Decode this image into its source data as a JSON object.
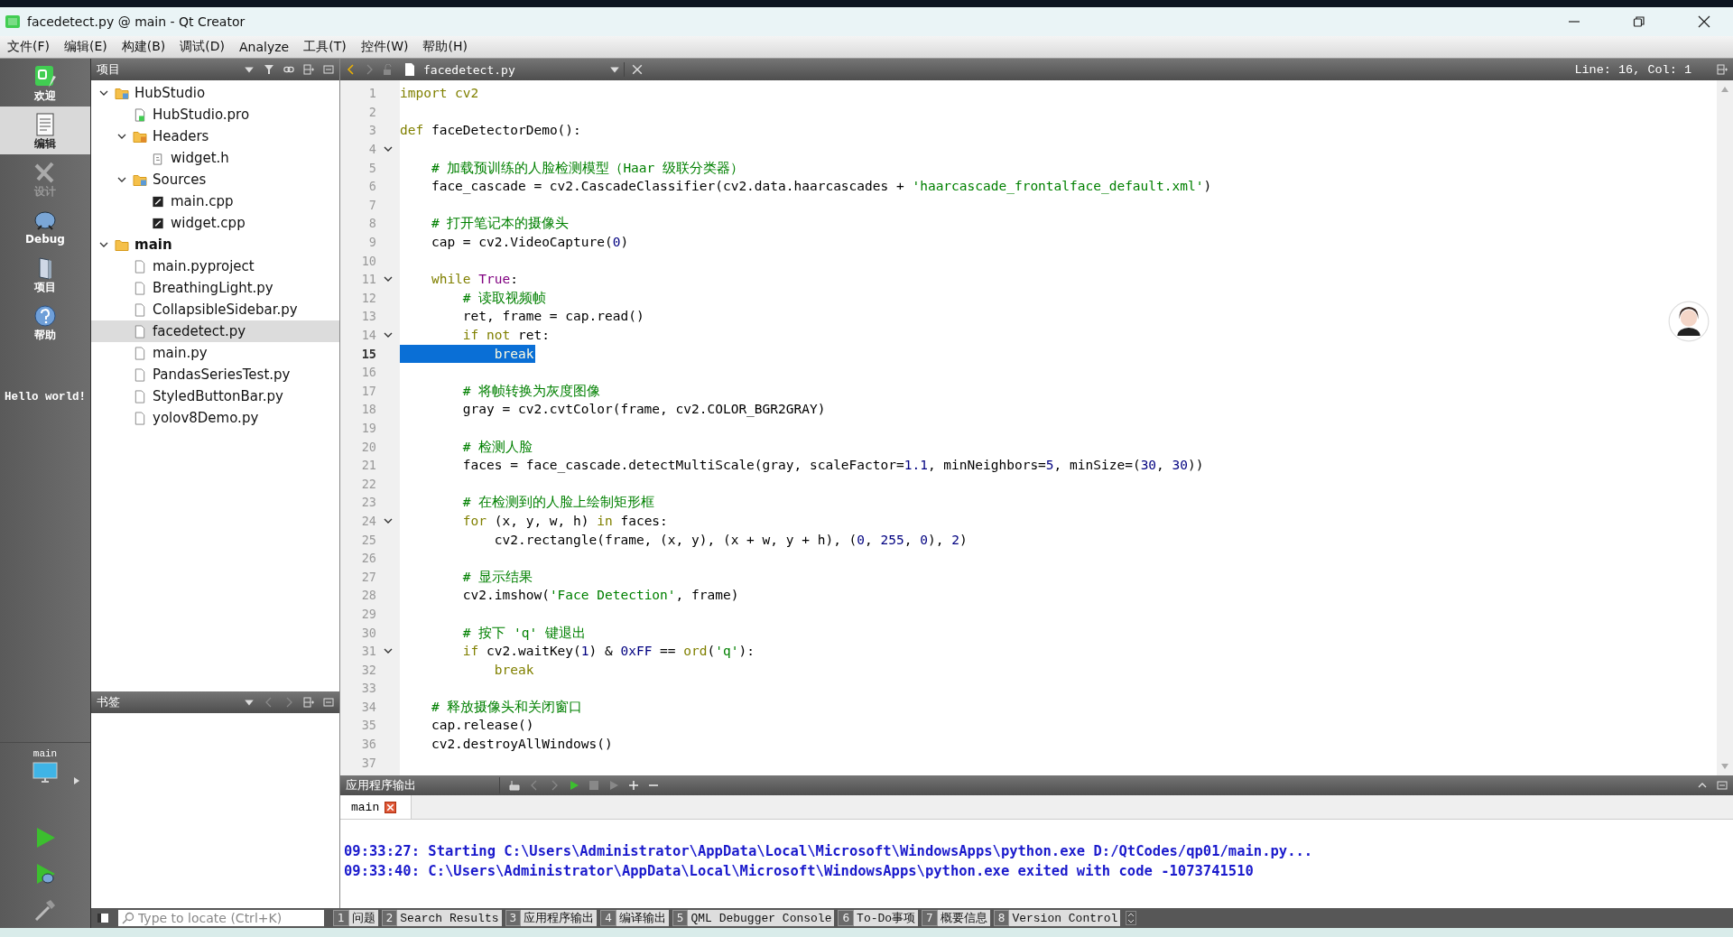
{
  "window": {
    "title": "facedetect.py @ main - Qt Creator"
  },
  "menu": [
    "文件(F)",
    "编辑(E)",
    "构建(B)",
    "调试(D)",
    "Analyze",
    "工具(T)",
    "控件(W)",
    "帮助(H)"
  ],
  "modes": [
    {
      "kind": "welcome",
      "label": "欢迎",
      "selected": false,
      "disabled": false
    },
    {
      "kind": "edit",
      "label": "编辑",
      "selected": true,
      "disabled": false
    },
    {
      "kind": "design",
      "label": "设计",
      "selected": false,
      "disabled": true
    },
    {
      "kind": "debug",
      "label": "Debug",
      "selected": false,
      "disabled": false
    },
    {
      "kind": "project",
      "label": "项目",
      "selected": false,
      "disabled": false
    },
    {
      "kind": "help",
      "label": "帮助",
      "selected": false,
      "disabled": false
    }
  ],
  "mode_note": "Hello world!",
  "kit": {
    "label": "main"
  },
  "project_pane": {
    "title": "项目",
    "items": [
      {
        "label": "HubStudio",
        "kind": "project",
        "expanded": true,
        "active": false,
        "selected": false,
        "children": [
          {
            "label": "HubStudio.pro",
            "kind": "qtpro",
            "selected": false
          },
          {
            "label": "Headers",
            "kind": "headers",
            "expanded": true,
            "selected": false,
            "children": [
              {
                "label": "widget.h",
                "kind": "header",
                "selected": false
              }
            ]
          },
          {
            "label": "Sources",
            "kind": "sources",
            "expanded": true,
            "selected": false,
            "children": [
              {
                "label": "main.cpp",
                "kind": "source",
                "selected": false
              },
              {
                "label": "widget.cpp",
                "kind": "source",
                "selected": false
              }
            ]
          }
        ]
      },
      {
        "label": "main",
        "kind": "project",
        "expanded": true,
        "active": true,
        "selected": false,
        "children": [
          {
            "label": "main.pyproject",
            "kind": "plain",
            "selected": false
          },
          {
            "label": "BreathingLight.py",
            "kind": "plain",
            "selected": false
          },
          {
            "label": "CollapsibleSidebar.py",
            "kind": "plain",
            "selected": false
          },
          {
            "label": "facedetect.py",
            "kind": "plain",
            "selected": true
          },
          {
            "label": "main.py",
            "kind": "plain",
            "selected": false
          },
          {
            "label": "PandasSeriesTest.py",
            "kind": "plain",
            "selected": false
          },
          {
            "label": "StyledButtonBar.py",
            "kind": "plain",
            "selected": false
          },
          {
            "label": "yolov8Demo.py",
            "kind": "plain",
            "selected": false
          }
        ]
      }
    ]
  },
  "bookmarks_pane": {
    "title": "书签"
  },
  "editor": {
    "file": "facedetect.py",
    "position": "Line: 16, Col: 1",
    "lines": [
      {
        "n": "1",
        "tokens": [
          {
            "kind": "kw",
            "text": "import cv2"
          }
        ]
      },
      {
        "n": "2"
      },
      {
        "n": "3",
        "tokens": [
          {
            "kind": "kw",
            "text": "def"
          },
          {
            "kind": "plain",
            "text": " faceDetectorDemo():"
          }
        ]
      },
      {
        "n": "4",
        "fold": true
      },
      {
        "n": "5",
        "tokens": [
          {
            "kind": "comment",
            "text": "    # 加载预训练的人脸检测模型（Haar 级联分类器）"
          }
        ]
      },
      {
        "n": "6",
        "tokens": [
          {
            "kind": "plain",
            "text": "    face_cascade = cv2.CascadeClassifier(cv2.data.haarcascades + "
          },
          {
            "kind": "str",
            "text": "'haarcascade_frontalface_default.xml'"
          },
          {
            "kind": "plain",
            "text": ")"
          }
        ]
      },
      {
        "n": "7"
      },
      {
        "n": "8",
        "tokens": [
          {
            "kind": "comment",
            "text": "    # 打开笔记本的摄像头"
          }
        ]
      },
      {
        "n": "9",
        "tokens": [
          {
            "kind": "plain",
            "text": "    cap = cv2.VideoCapture("
          },
          {
            "kind": "num",
            "text": "0"
          },
          {
            "kind": "plain",
            "text": ")"
          }
        ]
      },
      {
        "n": "10"
      },
      {
        "n": "11",
        "fold": true,
        "tokens": [
          {
            "kind": "kw",
            "text": "    while"
          },
          {
            "kind": "const",
            "text": " True"
          },
          {
            "kind": "plain",
            "text": ":"
          }
        ]
      },
      {
        "n": "12",
        "tokens": [
          {
            "kind": "comment",
            "text": "        # 读取视频帧"
          }
        ]
      },
      {
        "n": "13",
        "tokens": [
          {
            "kind": "plain",
            "text": "        ret, frame = cap.read()"
          }
        ]
      },
      {
        "n": "14",
        "fold": true,
        "tokens": [
          {
            "kind": "kw",
            "text": "        if"
          },
          {
            "kind": "kw",
            "text": " not"
          },
          {
            "kind": "plain",
            "text": " ret:"
          }
        ]
      },
      {
        "n": "15",
        "selected": true,
        "tokens": [
          {
            "kind": "kw",
            "text": "            break"
          }
        ]
      },
      {
        "n": "16"
      },
      {
        "n": "17",
        "tokens": [
          {
            "kind": "comment",
            "text": "        # 将帧转换为灰度图像"
          }
        ]
      },
      {
        "n": "18",
        "tokens": [
          {
            "kind": "plain",
            "text": "        gray = cv2.cvtColor(frame, cv2.COLOR_BGR2GRAY)"
          }
        ]
      },
      {
        "n": "19"
      },
      {
        "n": "20",
        "tokens": [
          {
            "kind": "comment",
            "text": "        # 检测人脸"
          }
        ]
      },
      {
        "n": "21",
        "tokens": [
          {
            "kind": "plain",
            "text": "        faces = face_cascade.detectMultiScale(gray, scaleFactor="
          },
          {
            "kind": "num",
            "text": "1.1"
          },
          {
            "kind": "plain",
            "text": ", minNeighbors="
          },
          {
            "kind": "num",
            "text": "5"
          },
          {
            "kind": "plain",
            "text": ", minSize=("
          },
          {
            "kind": "num",
            "text": "30"
          },
          {
            "kind": "plain",
            "text": ", "
          },
          {
            "kind": "num",
            "text": "30"
          },
          {
            "kind": "plain",
            "text": "))"
          }
        ]
      },
      {
        "n": "22"
      },
      {
        "n": "23",
        "tokens": [
          {
            "kind": "comment",
            "text": "        # 在检测到的人脸上绘制矩形框"
          }
        ]
      },
      {
        "n": "24",
        "fold": true,
        "tokens": [
          {
            "kind": "kw",
            "text": "        for"
          },
          {
            "kind": "plain",
            "text": " (x, y, w, h) "
          },
          {
            "kind": "kw",
            "text": "in"
          },
          {
            "kind": "plain",
            "text": " faces:"
          }
        ]
      },
      {
        "n": "25",
        "tokens": [
          {
            "kind": "plain",
            "text": "            cv2.rectangle(frame, (x, y), (x + w, y + h), ("
          },
          {
            "kind": "num",
            "text": "0"
          },
          {
            "kind": "plain",
            "text": ", "
          },
          {
            "kind": "num",
            "text": "255"
          },
          {
            "kind": "plain",
            "text": ", "
          },
          {
            "kind": "num",
            "text": "0"
          },
          {
            "kind": "plain",
            "text": "), "
          },
          {
            "kind": "num",
            "text": "2"
          },
          {
            "kind": "plain",
            "text": ")"
          }
        ]
      },
      {
        "n": "26"
      },
      {
        "n": "27",
        "tokens": [
          {
            "kind": "comment",
            "text": "        # 显示结果"
          }
        ]
      },
      {
        "n": "28",
        "tokens": [
          {
            "kind": "plain",
            "text": "        cv2.imshow("
          },
          {
            "kind": "str",
            "text": "'Face Detection'"
          },
          {
            "kind": "plain",
            "text": ", frame)"
          }
        ]
      },
      {
        "n": "29"
      },
      {
        "n": "30",
        "tokens": [
          {
            "kind": "comment",
            "text": "        # 按下 'q' 键退出"
          }
        ]
      },
      {
        "n": "31",
        "fold": true,
        "tokens": [
          {
            "kind": "kw",
            "text": "        if"
          },
          {
            "kind": "plain",
            "text": " cv2.waitKey("
          },
          {
            "kind": "num",
            "text": "1"
          },
          {
            "kind": "plain",
            "text": ") & "
          },
          {
            "kind": "num",
            "text": "0xFF"
          },
          {
            "kind": "plain",
            "text": " == "
          },
          {
            "kind": "builtin",
            "text": "ord"
          },
          {
            "kind": "plain",
            "text": "("
          },
          {
            "kind": "str",
            "text": "'q'"
          },
          {
            "kind": "plain",
            "text": "):"
          }
        ]
      },
      {
        "n": "32",
        "tokens": [
          {
            "kind": "kw",
            "text": "            break"
          }
        ]
      },
      {
        "n": "33"
      },
      {
        "n": "34",
        "tokens": [
          {
            "kind": "comment",
            "text": "    # 释放摄像头和关闭窗口"
          }
        ]
      },
      {
        "n": "35",
        "tokens": [
          {
            "kind": "plain",
            "text": "    cap.release()"
          }
        ]
      },
      {
        "n": "36",
        "tokens": [
          {
            "kind": "plain",
            "text": "    cv2.destroyAllWindows()"
          }
        ]
      },
      {
        "n": "37"
      }
    ]
  },
  "output": {
    "title": "应用程序输出",
    "tabs": [
      {
        "label": "main"
      }
    ],
    "lines": [
      "09:33:27: Starting C:\\Users\\Administrator\\AppData\\Local\\Microsoft\\WindowsApps\\python.exe D:/QtCodes/qp01/main.py...",
      "09:33:40: C:\\Users\\Administrator\\AppData\\Local\\Microsoft\\WindowsApps\\python.exe exited with code -1073741510"
    ]
  },
  "status_bar": {
    "locator_placeholder": "Type to locate (Ctrl+K)",
    "panes": [
      {
        "number": "1",
        "label": "问题"
      },
      {
        "number": "2",
        "label": "Search Results"
      },
      {
        "number": "3",
        "label": "应用程序输出"
      },
      {
        "number": "4",
        "label": "编译输出"
      },
      {
        "number": "5",
        "label": "QML Debugger Console"
      },
      {
        "number": "6",
        "label": "To-Do事项"
      },
      {
        "number": "7",
        "label": "概要信息"
      },
      {
        "number": "8",
        "label": "Version Control"
      }
    ]
  }
}
